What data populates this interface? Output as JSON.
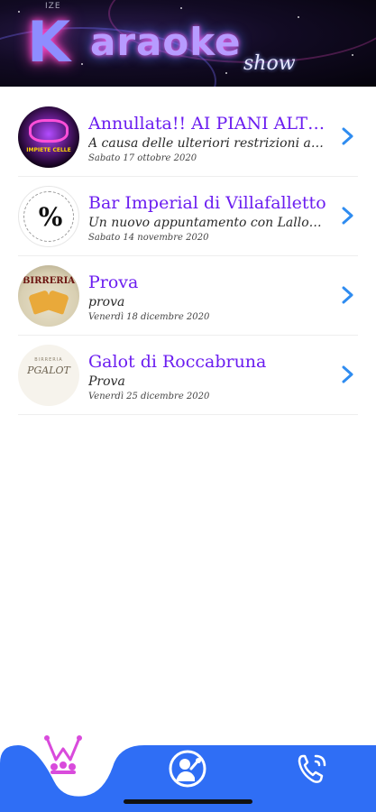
{
  "header": {
    "logo_small": "IZE",
    "logo_k": "K",
    "logo_text": "araoke",
    "logo_show": "show"
  },
  "events": [
    {
      "title": "Annullata!! AI PIANI ALTI di Villafalletto",
      "subtitle": "A causa delle ulteriori restrizioni adottate",
      "date": "Sabato 17 ottobre 2020",
      "thumb_text": "IMPIETE CELLE"
    },
    {
      "title": "Bar Imperial di Villafalletto",
      "subtitle": "Un nuovo appuntamento con LalloSax",
      "date": "Sabato 14 novembre 2020",
      "thumb_text": "%"
    },
    {
      "title": "Prova",
      "subtitle": "prova",
      "date": "Venerdì 18 dicembre 2020",
      "thumb_text": "BIRRERIA"
    },
    {
      "title": "Galot di Roccabruna",
      "subtitle": "Prova",
      "date": "Venerdì 25 dicembre 2020",
      "thumb_text": "PGALOT",
      "thumb_sub": "BIRRERIA"
    }
  ],
  "tabbar": {
    "tabs": [
      {
        "name": "karaoke",
        "icon": "karaoke-logo-icon",
        "active": true
      },
      {
        "name": "singer",
        "icon": "singer-icon",
        "active": false
      },
      {
        "name": "contacts",
        "icon": "phone-icon",
        "active": false
      }
    ]
  },
  "colors": {
    "accent": "#6b1df0",
    "chevron": "#2f8cf0",
    "tabbar": "#2f6ef5",
    "active_icon": "#d94bdc"
  }
}
